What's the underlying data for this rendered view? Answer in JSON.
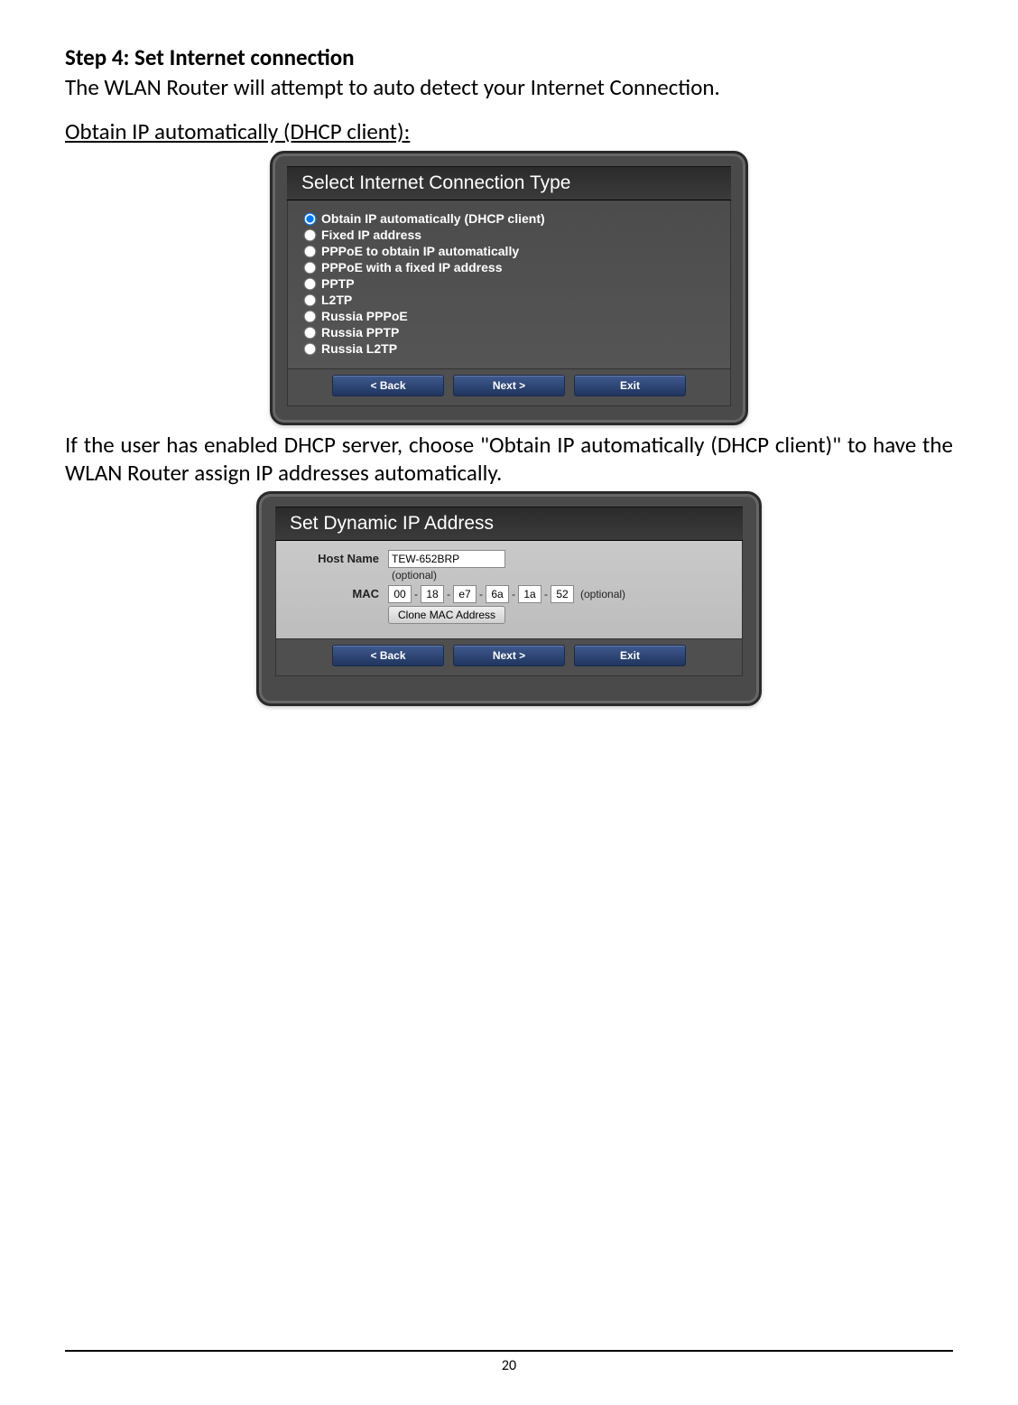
{
  "step": {
    "heading": "Step 4: Set Internet connection",
    "intro": "The WLAN Router will attempt to auto detect your Internet Connection.",
    "subheading": "Obtain IP automatically (DHCP client):"
  },
  "panel1": {
    "title": "Select Internet Connection Type",
    "options": [
      "Obtain IP automatically (DHCP client)",
      "Fixed IP address",
      "PPPoE to obtain IP automatically",
      "PPPoE with a fixed IP address",
      "PPTP",
      "L2TP",
      "Russia PPPoE",
      "Russia PPTP",
      "Russia L2TP"
    ],
    "buttons": {
      "back": "< Back",
      "next": "Next >",
      "exit": "Exit"
    }
  },
  "para2": "If the user has enabled DHCP server, choose \"Obtain IP automatically (DHCP client)\" to have the WLAN Router assign IP addresses automatically.",
  "panel2": {
    "title": "Set Dynamic IP Address",
    "hostname_label": "Host Name",
    "hostname_value": "TEW-652BRP",
    "hostname_optional": "(optional)",
    "mac_label": "MAC",
    "mac": [
      "00",
      "18",
      "e7",
      "6a",
      "1a",
      "52"
    ],
    "mac_optional": "(optional)",
    "clone_label": "Clone MAC Address",
    "buttons": {
      "back": "< Back",
      "next": "Next >",
      "exit": "Exit"
    }
  },
  "page_number": "20"
}
